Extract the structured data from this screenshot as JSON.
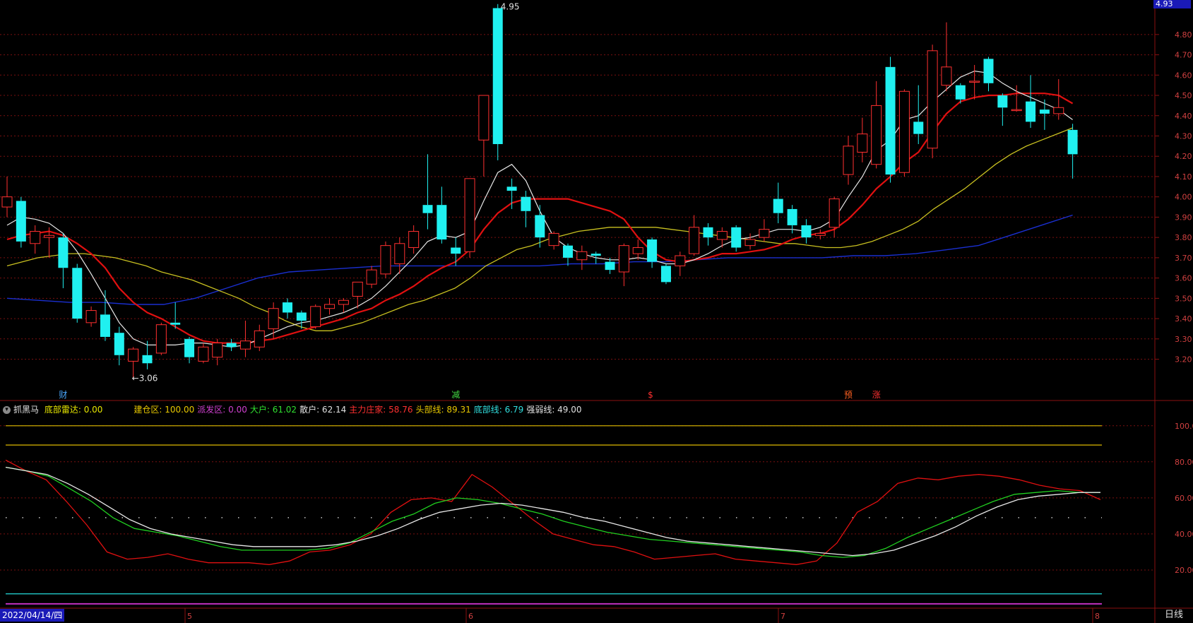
{
  "price_tag": "4.93",
  "date_label": "2022/04/14/四",
  "period_tab": "日线",
  "high_marker": "4.95",
  "low_marker": "←3.06",
  "price_axis": [
    "4.80",
    "4.70",
    "4.60",
    "4.50",
    "4.40",
    "4.30",
    "4.20",
    "4.10",
    "4.00",
    "3.90",
    "3.80",
    "3.70",
    "3.60",
    "3.50",
    "3.40",
    "3.30",
    "3.20"
  ],
  "ind_axis": [
    "100.0",
    "80.00",
    "60.00",
    "40.00",
    "20.00"
  ],
  "month_labels": [
    "5",
    "6",
    "7",
    "8"
  ],
  "event_markers": [
    {
      "text": "财",
      "color": "#4aa8ff"
    },
    {
      "text": "减",
      "color": "#44dd44"
    },
    {
      "text": "$",
      "color": "#ff3030"
    },
    {
      "text": "预",
      "color": "#ff6020"
    },
    {
      "text": "涨",
      "color": "#ff3030"
    }
  ],
  "indicator": {
    "name": "抓黑马",
    "items": [
      {
        "text": "底部雷达: 0.00",
        "color": "#e8e800"
      },
      {
        "text": "建仓区: 100.00",
        "color": "#e8c800"
      },
      {
        "text": "派发区: 0.00",
        "color": "#d040d0"
      },
      {
        "text": "大户: 61.02",
        "color": "#30e030"
      },
      {
        "text": "散户: 62.14",
        "color": "#e0e0e0"
      },
      {
        "text": "主力庄家: 58.76",
        "color": "#ff3030"
      },
      {
        "text": "头部线: 89.31",
        "color": "#e8c800"
      },
      {
        "text": "底部线: 6.79",
        "color": "#30e0e0"
      },
      {
        "text": "强弱线: 49.00",
        "color": "#e0e0e0"
      }
    ]
  },
  "chart_data": {
    "type": "candlestick",
    "price_ylim": [
      3.0,
      4.97
    ],
    "indicator_ylim": [
      0,
      105
    ],
    "candles": [
      [
        3.95,
        4.0,
        4.1,
        3.9
      ],
      [
        3.98,
        3.78,
        4.0,
        3.75
      ],
      [
        3.77,
        3.83,
        3.86,
        3.72
      ],
      [
        3.8,
        3.81,
        3.85,
        3.7
      ],
      [
        3.8,
        3.65,
        3.82,
        3.55
      ],
      [
        3.65,
        3.4,
        3.67,
        3.38
      ],
      [
        3.38,
        3.44,
        3.46,
        3.36
      ],
      [
        3.42,
        3.31,
        3.54,
        3.29
      ],
      [
        3.33,
        3.22,
        3.36,
        3.17
      ],
      [
        3.19,
        3.25,
        3.26,
        3.1
      ],
      [
        3.22,
        3.18,
        3.29,
        3.15
      ],
      [
        3.23,
        3.37,
        3.38,
        3.22
      ],
      [
        3.38,
        3.37,
        3.48,
        3.35
      ],
      [
        3.3,
        3.21,
        3.31,
        3.18
      ],
      [
        3.19,
        3.26,
        3.28,
        3.18
      ],
      [
        3.21,
        3.28,
        3.3,
        3.17
      ],
      [
        3.28,
        3.26,
        3.3,
        3.24
      ],
      [
        3.25,
        3.29,
        3.39,
        3.21
      ],
      [
        3.26,
        3.34,
        3.37,
        3.24
      ],
      [
        3.35,
        3.45,
        3.48,
        3.3
      ],
      [
        3.48,
        3.43,
        3.5,
        3.4
      ],
      [
        3.43,
        3.39,
        3.44,
        3.35
      ],
      [
        3.36,
        3.46,
        3.47,
        3.35
      ],
      [
        3.45,
        3.47,
        3.5,
        3.42
      ],
      [
        3.47,
        3.49,
        3.5,
        3.43
      ],
      [
        3.51,
        3.58,
        3.58,
        3.45
      ],
      [
        3.57,
        3.64,
        3.66,
        3.55
      ],
      [
        3.62,
        3.76,
        3.78,
        3.6
      ],
      [
        3.67,
        3.77,
        3.8,
        3.62
      ],
      [
        3.75,
        3.83,
        3.86,
        3.72
      ],
      [
        3.96,
        3.92,
        4.21,
        3.84
      ],
      [
        3.96,
        3.79,
        4.05,
        3.77
      ],
      [
        3.75,
        3.72,
        3.8,
        3.66
      ],
      [
        3.73,
        4.09,
        4.09,
        3.7
      ],
      [
        4.28,
        4.5,
        4.5,
        4.1
      ],
      [
        4.93,
        4.26,
        4.95,
        4.18
      ],
      [
        4.05,
        4.03,
        4.09,
        3.94
      ],
      [
        4.0,
        3.93,
        4.03,
        3.85
      ],
      [
        3.91,
        3.8,
        3.96,
        3.75
      ],
      [
        3.76,
        3.82,
        3.83,
        3.74
      ],
      [
        3.76,
        3.7,
        3.77,
        3.66
      ],
      [
        3.69,
        3.73,
        3.76,
        3.64
      ],
      [
        3.72,
        3.71,
        3.73,
        3.67
      ],
      [
        3.68,
        3.64,
        3.7,
        3.62
      ],
      [
        3.63,
        3.76,
        3.77,
        3.56
      ],
      [
        3.72,
        3.75,
        3.79,
        3.69
      ],
      [
        3.79,
        3.68,
        3.8,
        3.65
      ],
      [
        3.66,
        3.58,
        3.67,
        3.57
      ],
      [
        3.66,
        3.71,
        3.73,
        3.61
      ],
      [
        3.72,
        3.85,
        3.91,
        3.71
      ],
      [
        3.85,
        3.8,
        3.87,
        3.76
      ],
      [
        3.79,
        3.83,
        3.85,
        3.75
      ],
      [
        3.85,
        3.75,
        3.86,
        3.73
      ],
      [
        3.76,
        3.79,
        3.82,
        3.74
      ],
      [
        3.8,
        3.84,
        3.89,
        3.78
      ],
      [
        3.99,
        3.92,
        4.07,
        3.87
      ],
      [
        3.94,
        3.86,
        3.96,
        3.82
      ],
      [
        3.86,
        3.8,
        3.89,
        3.77
      ],
      [
        3.81,
        3.82,
        3.84,
        3.79
      ],
      [
        3.85,
        3.99,
        4.0,
        3.8
      ],
      [
        4.11,
        4.25,
        4.3,
        4.06
      ],
      [
        4.22,
        4.31,
        4.39,
        4.17
      ],
      [
        4.16,
        4.45,
        4.57,
        4.14
      ],
      [
        4.64,
        4.11,
        4.69,
        4.07
      ],
      [
        4.12,
        4.52,
        4.53,
        4.1
      ],
      [
        4.37,
        4.31,
        4.55,
        4.26
      ],
      [
        4.24,
        4.72,
        4.75,
        4.19
      ],
      [
        4.55,
        4.64,
        4.86,
        4.52
      ],
      [
        4.55,
        4.48,
        4.56,
        4.46
      ],
      [
        4.57,
        4.57,
        4.65,
        4.48
      ],
      [
        4.68,
        4.56,
        4.69,
        4.52
      ],
      [
        4.5,
        4.44,
        4.51,
        4.35
      ],
      [
        4.43,
        4.43,
        4.55,
        4.42
      ],
      [
        4.47,
        4.37,
        4.6,
        4.34
      ],
      [
        4.43,
        4.41,
        4.48,
        4.33
      ],
      [
        4.41,
        4.44,
        4.58,
        4.38
      ],
      [
        4.33,
        4.21,
        4.36,
        4.09
      ]
    ],
    "ma_white": [
      3.86,
      3.9,
      3.89,
      3.87,
      3.82,
      3.73,
      3.62,
      3.5,
      3.38,
      3.3,
      3.27,
      3.27,
      3.27,
      3.28,
      3.28,
      3.27,
      3.26,
      3.27,
      3.3,
      3.33,
      3.36,
      3.38,
      3.39,
      3.41,
      3.43,
      3.46,
      3.5,
      3.56,
      3.63,
      3.7,
      3.78,
      3.81,
      3.8,
      3.83,
      3.98,
      4.12,
      4.16,
      4.08,
      3.93,
      3.8,
      3.75,
      3.72,
      3.7,
      3.69,
      3.69,
      3.7,
      3.69,
      3.67,
      3.67,
      3.69,
      3.72,
      3.76,
      3.79,
      3.8,
      3.82,
      3.84,
      3.84,
      3.83,
      3.85,
      3.89,
      4.0,
      4.1,
      4.23,
      4.28,
      4.38,
      4.4,
      4.47,
      4.53,
      4.59,
      4.62,
      4.61,
      4.56,
      4.52,
      4.49,
      4.46,
      4.43,
      4.38
    ],
    "ma_red": [
      3.79,
      3.81,
      3.82,
      3.83,
      3.81,
      3.77,
      3.72,
      3.65,
      3.55,
      3.48,
      3.43,
      3.4,
      3.36,
      3.32,
      3.29,
      3.28,
      3.28,
      3.28,
      3.29,
      3.3,
      3.32,
      3.34,
      3.36,
      3.38,
      3.4,
      3.43,
      3.45,
      3.49,
      3.52,
      3.56,
      3.61,
      3.65,
      3.68,
      3.74,
      3.84,
      3.92,
      3.97,
      3.99,
      3.99,
      3.99,
      3.99,
      3.97,
      3.95,
      3.93,
      3.89,
      3.8,
      3.73,
      3.69,
      3.68,
      3.69,
      3.7,
      3.72,
      3.72,
      3.73,
      3.74,
      3.76,
      3.79,
      3.81,
      3.82,
      3.84,
      3.89,
      3.96,
      4.04,
      4.1,
      4.17,
      4.22,
      4.32,
      4.41,
      4.47,
      4.49,
      4.5,
      4.5,
      4.51,
      4.51,
      4.51,
      4.5,
      4.46
    ],
    "ma_yellow": [
      3.66,
      3.68,
      3.7,
      3.71,
      3.72,
      3.72,
      3.71,
      3.7,
      3.68,
      3.66,
      3.63,
      3.61,
      3.59,
      3.56,
      3.53,
      3.5,
      3.46,
      3.43,
      3.39,
      3.36,
      3.34,
      3.34,
      3.36,
      3.38,
      3.41,
      3.44,
      3.47,
      3.49,
      3.52,
      3.55,
      3.6,
      3.66,
      3.7,
      3.74,
      3.76,
      3.79,
      3.81,
      3.83,
      3.84,
      3.85,
      3.85,
      3.85,
      3.85,
      3.84,
      3.83,
      3.82,
      3.81,
      3.8,
      3.79,
      3.78,
      3.77,
      3.77,
      3.76,
      3.75,
      3.75,
      3.76,
      3.78,
      3.81,
      3.84,
      3.88,
      3.94,
      3.99,
      4.04,
      4.1,
      4.16,
      4.21,
      4.25,
      4.28,
      4.31,
      4.34
    ],
    "ma_blue": [
      3.5,
      3.49,
      3.48,
      3.48,
      3.47,
      3.47,
      3.5,
      3.55,
      3.6,
      3.63,
      3.64,
      3.65,
      3.66,
      3.66,
      3.66,
      3.66,
      3.66,
      3.66,
      3.67,
      3.67,
      3.68,
      3.68,
      3.69,
      3.7,
      3.7,
      3.7,
      3.7,
      3.71,
      3.71,
      3.72,
      3.74,
      3.76,
      3.81,
      3.86,
      3.91
    ],
    "ind_white": [
      77,
      75,
      73,
      68,
      62,
      55,
      48,
      43,
      40,
      38,
      36,
      34,
      33,
      33,
      33,
      33,
      34,
      36,
      39,
      43,
      48,
      52,
      54,
      56,
      57,
      56,
      54,
      52,
      49,
      47,
      44,
      41,
      38,
      36,
      35,
      34,
      33,
      32,
      31,
      30,
      29,
      28,
      29,
      31,
      35,
      39,
      44,
      50,
      55,
      59,
      61,
      62,
      63,
      63
    ],
    "ind_green": [
      77,
      75,
      72,
      65,
      58,
      49,
      43,
      41,
      39,
      36,
      33,
      31,
      31,
      31,
      31,
      32,
      35,
      41,
      47,
      51,
      57,
      60,
      59,
      57,
      54,
      51,
      47,
      44,
      41,
      39,
      37,
      36,
      35,
      34,
      33,
      32,
      31,
      30,
      28,
      27,
      28,
      32,
      38,
      43,
      48,
      53,
      58,
      62,
      63,
      64,
      63,
      63
    ],
    "ind_red": [
      81,
      75,
      70,
      58,
      45,
      30,
      26,
      27,
      29,
      26,
      24,
      24,
      24,
      23,
      25,
      30,
      31,
      34,
      40,
      52,
      59,
      60,
      58,
      73,
      66,
      57,
      48,
      40,
      37,
      34,
      33,
      30,
      26,
      27,
      28,
      29,
      26,
      25,
      24,
      23,
      25,
      35,
      52,
      58,
      68,
      71,
      70,
      72,
      73,
      72,
      70,
      67,
      65,
      64,
      59
    ],
    "ind_grey_dotted": 49,
    "ind_head_line": 89.31,
    "ind_bottom_line": 6.79
  }
}
